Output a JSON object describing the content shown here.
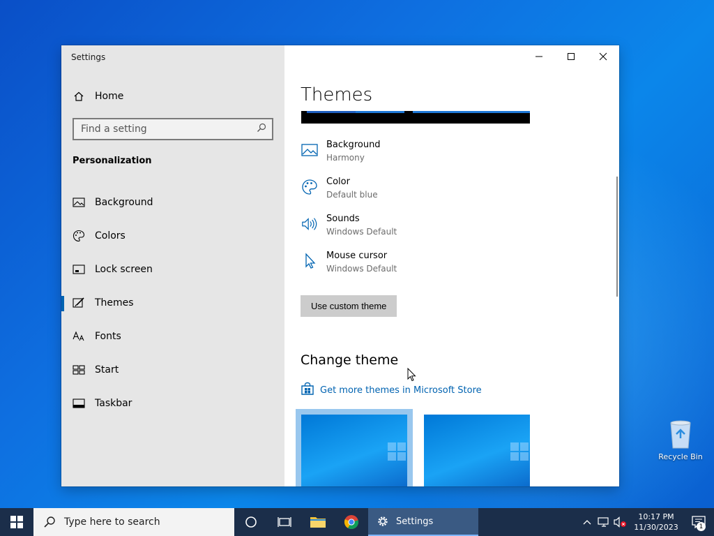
{
  "window": {
    "title": "Settings"
  },
  "sidebar": {
    "home_label": "Home",
    "search_placeholder": "Find a setting",
    "section_title": "Personalization",
    "items": [
      {
        "label": "Background"
      },
      {
        "label": "Colors"
      },
      {
        "label": "Lock screen"
      },
      {
        "label": "Themes"
      },
      {
        "label": "Fonts"
      },
      {
        "label": "Start"
      },
      {
        "label": "Taskbar"
      }
    ],
    "active_item": "Themes"
  },
  "main": {
    "page_title": "Themes",
    "settings": [
      {
        "name": "Background",
        "value": "Harmony",
        "icon": "picture-icon"
      },
      {
        "name": "Color",
        "value": "Default blue",
        "icon": "palette-icon"
      },
      {
        "name": "Sounds",
        "value": "Windows Default",
        "icon": "speaker-icon"
      },
      {
        "name": "Mouse cursor",
        "value": "Windows Default",
        "icon": "pointer-icon"
      }
    ],
    "custom_theme_button": "Use custom theme",
    "change_theme_heading": "Change theme",
    "store_link": "Get more themes in Microsoft Store"
  },
  "desktop": {
    "recycle_bin_label": "Recycle Bin"
  },
  "taskbar": {
    "search_placeholder": "Type here to search",
    "settings_label": "Settings",
    "time": "10:17 PM",
    "date": "11/30/2023",
    "notification_count": "1"
  },
  "colors": {
    "accent": "#0063b1",
    "taskbar": "#1b2e4a",
    "sidebar_bg": "#e6e6e6"
  }
}
